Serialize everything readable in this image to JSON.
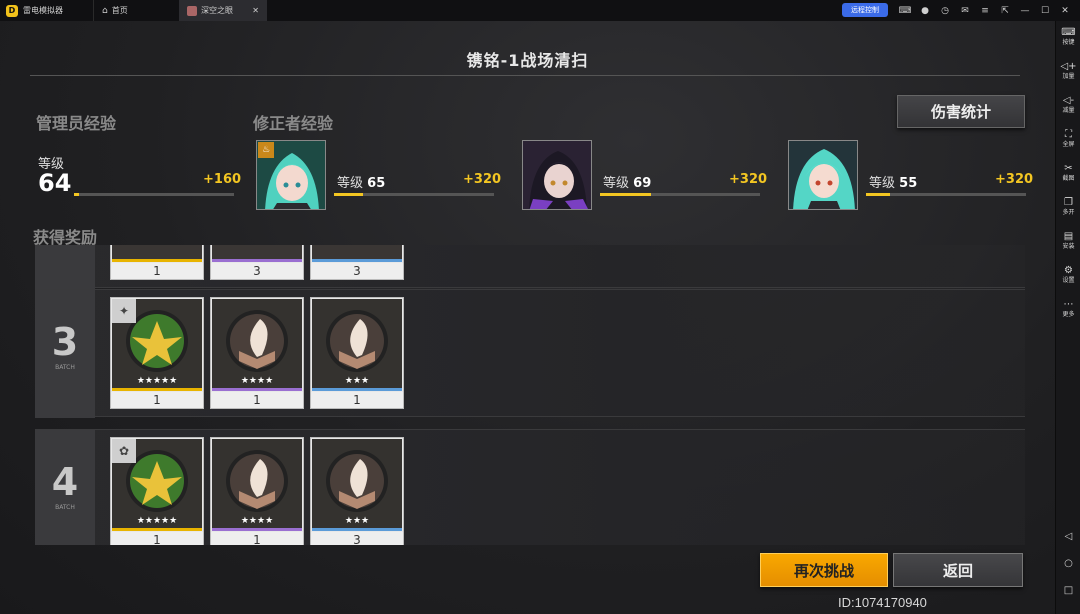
{
  "titlebar": {
    "app_name": "雷电模拟器",
    "tabs": [
      {
        "label": "首页"
      },
      {
        "label": "深空之眼"
      }
    ],
    "remote_label": "远程控制"
  },
  "sidebar": {
    "items": [
      {
        "label": "按键",
        "icon": "keyboard-icon"
      },
      {
        "label": "加量",
        "icon": "volume-up-icon"
      },
      {
        "label": "减量",
        "icon": "volume-down-icon"
      },
      {
        "label": "全屏",
        "icon": "fullscreen-icon"
      },
      {
        "label": "截图",
        "icon": "scissors-icon"
      },
      {
        "label": "多开",
        "icon": "multi-instance-icon"
      },
      {
        "label": "安装",
        "icon": "apk-icon"
      },
      {
        "label": "设置",
        "icon": "gear-icon"
      },
      {
        "label": "更多",
        "icon": "more-icon"
      }
    ]
  },
  "game": {
    "title": "镌铭-1战场清扫",
    "admin_exp_label": "管理员经验",
    "modifier_exp_label": "修正者经验",
    "damage_stats_label": "伤害统计",
    "admin": {
      "level_label": "等级",
      "level": "64",
      "exp_gain": "+160",
      "progress": 0.03
    },
    "characters": [
      {
        "level_label": "等级",
        "level": "65",
        "exp_gain": "+320",
        "progress": 0.18
      },
      {
        "level_label": "等级",
        "level": "69",
        "exp_gain": "+320",
        "progress": 0.32
      },
      {
        "level_label": "等级",
        "level": "55",
        "exp_gain": "+320",
        "progress": 0.15
      }
    ],
    "rewards_label": "获得奖励",
    "batches": [
      {
        "num": "",
        "batch_label": "",
        "items": [
          {
            "count": "1",
            "rarity": "gold"
          },
          {
            "count": "3",
            "rarity": "purple"
          },
          {
            "count": "3",
            "rarity": "blue"
          }
        ]
      },
      {
        "num": "3",
        "batch_label": "BATCH",
        "items": [
          {
            "count": "1",
            "rarity": "gold",
            "stars": "★★★★★"
          },
          {
            "count": "1",
            "rarity": "purple",
            "stars": "★★★★"
          },
          {
            "count": "1",
            "rarity": "blue",
            "stars": "★★★"
          }
        ]
      },
      {
        "num": "4",
        "batch_label": "BATCH",
        "items": [
          {
            "count": "1",
            "rarity": "gold",
            "stars": "★★★★★"
          },
          {
            "count": "1",
            "rarity": "purple",
            "stars": "★★★★"
          },
          {
            "count": "3",
            "rarity": "blue",
            "stars": "★★★"
          }
        ]
      }
    ],
    "retry_label": "再次挑战",
    "back_label": "返回",
    "uid": "ID:1074170940"
  },
  "colors": {
    "accent": "#f3c622",
    "retry": "#f9a800",
    "gold": "#e8b400",
    "purple": "#9a6fd1",
    "blue": "#5b9bd8"
  }
}
